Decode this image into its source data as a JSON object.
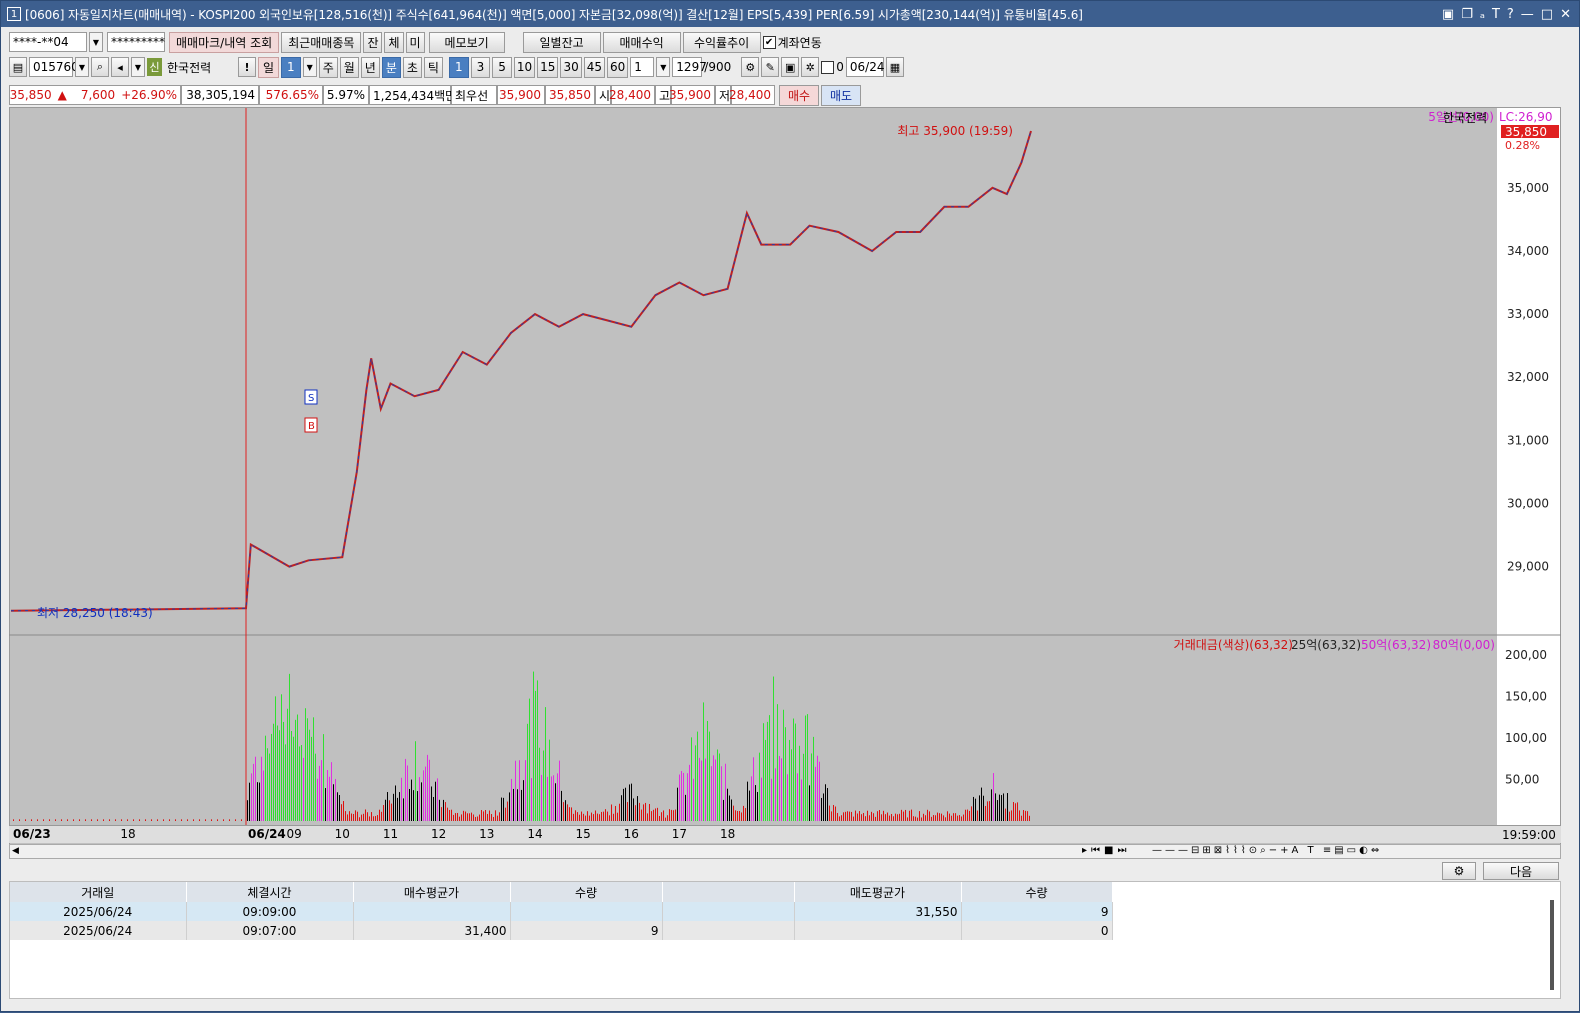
{
  "title": "[0606] 자동일지차트(매매내역) - KOSPI200 외국인보유[128,516(천)] 주식수[641,964(천)] 액면[5,000] 자본금[32,098(억)] 결산[12월] EPS[5,439] PER[6.59] 시가총액[230,144(억)] 유통비율[45.6]",
  "title_num": "1",
  "title_controls": [
    "▣",
    "❐",
    "ₐ",
    "T",
    "?",
    "—",
    "□",
    "✕"
  ],
  "toolbar1": {
    "account": "****-**04",
    "password": "*********",
    "btn_mark": "매매마크/내역 조회",
    "btn_recent": "최근매매종목",
    "btn_jan": "잔",
    "btn_che": "체",
    "btn_mi": "미",
    "btn_memo": "메모보기",
    "btn_daily": "일별잔고",
    "btn_profit": "매매수익",
    "btn_rate": "수익률추이",
    "link_label": "계좌연동"
  },
  "toolbar2": {
    "code": "015760",
    "badge": "신",
    "name": "한국전력",
    "excl": "!",
    "period_day": "일",
    "period_sel": "1",
    "periods": [
      "주",
      "월",
      "년",
      "분",
      "초",
      "틱"
    ],
    "intervals": [
      "1",
      "3",
      "5",
      "10",
      "15",
      "30",
      "45",
      "60"
    ],
    "interval_input": "1",
    "count": "1297",
    "count_max": "/900",
    "zero_label": "0",
    "date": "06/24"
  },
  "quote": {
    "price": "35,850",
    "arrow": "▲",
    "change": "7,600",
    "rate": "+26.90%",
    "volume": "38,305,194",
    "vol_rate": "576.65%",
    "turnover": "5.97%",
    "amount": "1,254,434백만",
    "best_label": "최우선",
    "best_ask": "35,900",
    "best_bid": "35,850",
    "open_label": "시",
    "open": "28,400",
    "high_label": "고",
    "high": "35,900",
    "low_label": "저",
    "low": "28,400",
    "buy": "매수",
    "sell": "매도"
  },
  "chart_labels": {
    "ma_legend": "5일선(0,00)",
    "stock_legend": "한국전력",
    "lc": "LC:26,90",
    "last_price": "35,850",
    "last_pct": "0.28%",
    "high_note": "최고 35,900 (19:59)",
    "low_note": "최저 28,250 (18:43)",
    "sell_mark": "S",
    "buy_mark": "B",
    "vol_legend1": "거래대금(색상)(63,32)",
    "vol_legend2": "25억(63,32)",
    "vol_legend3": "50억(63,32)",
    "vol_legend4": "80억(0,00)",
    "time_label": "19:59:00"
  },
  "chart_data": {
    "type": "line",
    "price_ticks": [
      "35,000",
      "34,000",
      "33,000",
      "32,000",
      "31,000",
      "30,000",
      "29,000"
    ],
    "volume_ticks": [
      "200,00",
      "150,00",
      "100,00",
      "50,00"
    ],
    "x_ticks": [
      "06/23",
      "18",
      "06/24",
      "09",
      "10",
      "11",
      "12",
      "13",
      "14",
      "15",
      "16",
      "17",
      "18"
    ],
    "price_path": [
      [
        0,
        28300
      ],
      [
        3.5,
        28340
      ],
      [
        3.6,
        29350
      ],
      [
        4.4,
        29000
      ],
      [
        4.8,
        29100
      ],
      [
        5.5,
        29150
      ],
      [
        5.8,
        30500
      ],
      [
        6.0,
        31800
      ],
      [
        6.1,
        32300
      ],
      [
        6.3,
        31500
      ],
      [
        6.5,
        31900
      ],
      [
        7.0,
        31700
      ],
      [
        7.5,
        31800
      ],
      [
        8.0,
        32400
      ],
      [
        8.5,
        32200
      ],
      [
        9.0,
        32700
      ],
      [
        9.5,
        33000
      ],
      [
        10.0,
        32800
      ],
      [
        10.5,
        33000
      ],
      [
        11.0,
        32900
      ],
      [
        11.5,
        32800
      ],
      [
        12.0,
        33300
      ],
      [
        12.5,
        33500
      ],
      [
        13.0,
        33300
      ],
      [
        13.5,
        33400
      ],
      [
        13.9,
        34600
      ],
      [
        14.2,
        34100
      ],
      [
        14.8,
        34100
      ],
      [
        15.2,
        34400
      ],
      [
        15.8,
        34300
      ],
      [
        16.5,
        34000
      ],
      [
        17.0,
        34300
      ],
      [
        17.5,
        34300
      ],
      [
        18.0,
        34700
      ],
      [
        18.5,
        34700
      ],
      [
        19.0,
        35000
      ],
      [
        19.3,
        34900
      ],
      [
        19.6,
        35400
      ],
      [
        19.8,
        35900
      ]
    ],
    "volume_peaks": [
      [
        3.6,
        40
      ],
      [
        4.1,
        200
      ],
      [
        4.4,
        180
      ],
      [
        4.8,
        175
      ],
      [
        7.0,
        120
      ],
      [
        9.5,
        190
      ],
      [
        11.5,
        50
      ],
      [
        13.0,
        150
      ],
      [
        14.5,
        190
      ],
      [
        15.0,
        160
      ],
      [
        19.0,
        60
      ]
    ]
  },
  "bottom_bar": {
    "next": "다음"
  },
  "table": {
    "headers": [
      "거래일",
      "체결시간",
      "매수평균가",
      "수량",
      "",
      "매도평균가",
      "수량"
    ],
    "rows": [
      [
        "2025/06/24",
        "09:09:00",
        "",
        "",
        "",
        "31,550",
        "9"
      ],
      [
        "2025/06/24",
        "09:07:00",
        "31,400",
        "9",
        "",
        "",
        "0"
      ]
    ]
  }
}
